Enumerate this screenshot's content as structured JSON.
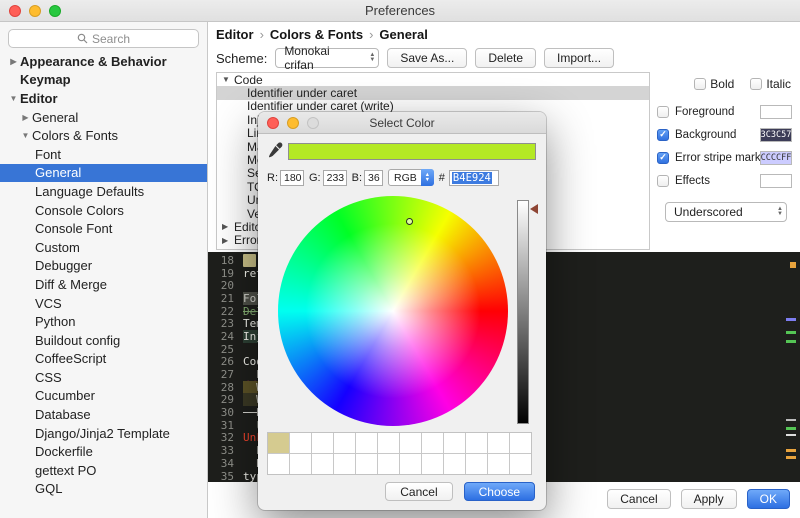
{
  "window": {
    "title": "Preferences"
  },
  "colors": {
    "accent": "#3875d6",
    "inactive_selection": "#d4d4d4",
    "preview_background": "#1e1f1c"
  },
  "sidebar": {
    "search_placeholder": "Search",
    "items": [
      {
        "label": "Appearance & Behavior",
        "level": 0,
        "bold": true,
        "arrow": "right"
      },
      {
        "label": "Keymap",
        "level": 0,
        "bold": true
      },
      {
        "label": "Editor",
        "level": 0,
        "bold": true,
        "arrow": "down"
      },
      {
        "label": "General",
        "level": 1,
        "arrow": "right"
      },
      {
        "label": "Colors & Fonts",
        "level": 1,
        "arrow": "down"
      },
      {
        "label": "Font",
        "level": 2
      },
      {
        "label": "General",
        "level": 2,
        "selected": true
      },
      {
        "label": "Language Defaults",
        "level": 2
      },
      {
        "label": "Console Colors",
        "level": 2
      },
      {
        "label": "Console Font",
        "level": 2
      },
      {
        "label": "Custom",
        "level": 2
      },
      {
        "label": "Debugger",
        "level": 2
      },
      {
        "label": "Diff & Merge",
        "level": 2
      },
      {
        "label": "VCS",
        "level": 2
      },
      {
        "label": "Python",
        "level": 2
      },
      {
        "label": "Buildout config",
        "level": 2
      },
      {
        "label": "CoffeeScript",
        "level": 2
      },
      {
        "label": "CSS",
        "level": 2
      },
      {
        "label": "Cucumber",
        "level": 2
      },
      {
        "label": "Database",
        "level": 2
      },
      {
        "label": "Django/Jinja2 Template",
        "level": 2
      },
      {
        "label": "Dockerfile",
        "level": 2
      },
      {
        "label": "gettext PO",
        "level": 2
      },
      {
        "label": "GQL",
        "level": 2
      }
    ]
  },
  "breadcrumb": {
    "parts": [
      "Editor",
      "Colors & Fonts",
      "General"
    ],
    "separator": "›"
  },
  "scheme": {
    "label": "Scheme:",
    "value": "Monokai crifan",
    "buttons": [
      "Save As...",
      "Delete",
      "Import..."
    ]
  },
  "options_tree": {
    "rows": [
      {
        "label": "Code",
        "kind": "group",
        "arrow": "down"
      },
      {
        "label": "Identifier under caret",
        "kind": "child",
        "selected": true
      },
      {
        "label": "Identifier under caret (write)",
        "kind": "child"
      },
      {
        "label": "Injected",
        "kind": "child"
      },
      {
        "label": "Line",
        "kind": "child"
      },
      {
        "label": "Matched",
        "kind": "child"
      },
      {
        "label": "Method",
        "kind": "child"
      },
      {
        "label": "Selection",
        "kind": "child"
      },
      {
        "label": "TODO",
        "kind": "child"
      },
      {
        "label": "Unmatched",
        "kind": "child"
      },
      {
        "label": "Vertical",
        "kind": "child"
      },
      {
        "label": "Editor",
        "kind": "group",
        "arrow": "right"
      },
      {
        "label": "Errors a",
        "kind": "group",
        "arrow": "right"
      }
    ]
  },
  "props": {
    "bold_label": "Bold",
    "italic_label": "Italic",
    "rows": [
      {
        "label": "Foreground",
        "checked": false,
        "swatch_color": "",
        "swatch_label": "",
        "swatch_text_color": "#333333"
      },
      {
        "label": "Background",
        "checked": true,
        "swatch_color": "#3C3C57",
        "swatch_label": "3C3C57",
        "swatch_text_color": "#FFFFFF"
      },
      {
        "label": "Error stripe mark",
        "checked": true,
        "swatch_color": "#CCCCFF",
        "swatch_label": "CCCCFF",
        "swatch_text_color": "#333333"
      },
      {
        "label": "Effects",
        "checked": false,
        "swatch_color": "",
        "swatch_label": "",
        "swatch_text_color": "#333333"
      }
    ],
    "effects_style": "Underscored"
  },
  "preview": {
    "lines": [
      {
        "num": "18",
        "frags": [
          {
            "t": "  ",
            "cls": "chip"
          },
          {
            "t": " = {",
            "cls": "text"
          },
          {
            "t": "\"",
            "cls": "string"
          }
        ]
      },
      {
        "num": "19",
        "frags": [
          {
            "t": "retur",
            "cls": "text"
          }
        ]
      },
      {
        "num": "20",
        "frags": []
      },
      {
        "num": "21",
        "frags": [
          {
            "t": "Folded",
            "cls": "folded"
          }
        ]
      },
      {
        "num": "22",
        "frags": [
          {
            "t": "Deleted",
            "cls": "deleted"
          }
        ]
      },
      {
        "num": "23",
        "frags": [
          {
            "t": "Templat",
            "cls": "text"
          }
        ]
      },
      {
        "num": "24",
        "frags": [
          {
            "t": "Injecte",
            "cls": "injected"
          }
        ]
      },
      {
        "num": "25",
        "frags": []
      },
      {
        "num": "26",
        "frags": [
          {
            "t": "Code In",
            "cls": "text"
          }
        ]
      },
      {
        "num": "27",
        "frags": [
          {
            "t": "  Error",
            "cls": "error"
          }
        ]
      },
      {
        "num": "28",
        "frags": [
          {
            "t": "  Warnin",
            "cls": "warning"
          }
        ]
      },
      {
        "num": "29",
        "frags": [
          {
            "t": "  Weak ",
            "cls": "weak"
          }
        ]
      },
      {
        "num": "30",
        "frags": [
          {
            "t": "  Deprec",
            "cls": "deprecated"
          }
        ]
      },
      {
        "num": "31",
        "frags": [
          {
            "t": "  Unused",
            "cls": "unused"
          }
        ]
      },
      {
        "num": "32",
        "frags": [
          {
            "t": "Unkno",
            "cls": "unknown"
          }
        ]
      },
      {
        "num": "33",
        "frags": [
          {
            "t": "  Probl",
            "cls": "text"
          }
        ]
      },
      {
        "num": "34",
        "frags": [
          {
            "t": "  Dupli",
            "cls": "text"
          }
        ]
      },
      {
        "num": "35",
        "frags": [
          {
            "t": "typo",
            "cls": "typo"
          }
        ]
      }
    ],
    "stripe_marks": [
      {
        "t": 10,
        "r": 4,
        "w": 6,
        "h": 6,
        "c": "#e8a33d"
      },
      {
        "t": 66,
        "r": 4,
        "w": 10,
        "h": 3,
        "c": "#7d7df0"
      },
      {
        "t": 79,
        "r": 4,
        "w": 10,
        "h": 3,
        "c": "#55c555"
      },
      {
        "t": 88,
        "r": 4,
        "w": 10,
        "h": 3,
        "c": "#55c555"
      },
      {
        "t": 167,
        "r": 4,
        "w": 10,
        "h": 2,
        "c": "#bbbbbb"
      },
      {
        "t": 175,
        "r": 4,
        "w": 10,
        "h": 3,
        "c": "#55c555"
      },
      {
        "t": 182,
        "r": 4,
        "w": 10,
        "h": 2,
        "c": "#dddddd"
      },
      {
        "t": 197,
        "r": 4,
        "w": 10,
        "h": 3,
        "c": "#e8a33d"
      },
      {
        "t": 204,
        "r": 4,
        "w": 10,
        "h": 3,
        "c": "#e8a33d"
      }
    ]
  },
  "dialog": {
    "title": "Select Color",
    "current_color": "#B4E924",
    "fields": {
      "r_label": "R:",
      "r_value": "180",
      "g_label": "G:",
      "g_value": "233",
      "b_label": "B:",
      "b_value": "36",
      "mode": "RGB",
      "hex_prefix": "#",
      "hex_value": "B4E924"
    },
    "saved_swatch_color": "#d5cb90",
    "swatch_count": 24,
    "cancel_label": "Cancel",
    "choose_label": "Choose"
  },
  "footer": {
    "cancel_label": "Cancel",
    "apply_label": "Apply",
    "ok_label": "OK"
  }
}
